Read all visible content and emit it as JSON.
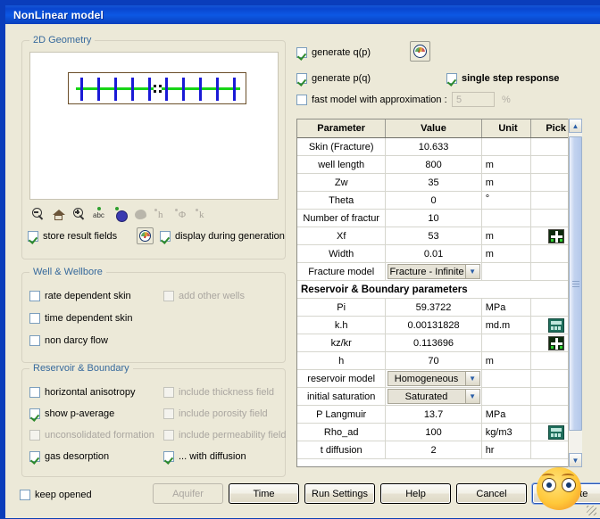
{
  "window": {
    "title": "NonLinear model"
  },
  "geometry_group": {
    "legend": "2D Geometry",
    "toolbar": [
      {
        "name": "zoom-out-icon",
        "label": "zoom out"
      },
      {
        "name": "home-icon",
        "label": "reset view"
      },
      {
        "name": "zoom-in-icon",
        "label": "zoom in"
      },
      {
        "name": "abc-icon",
        "label": "abc"
      },
      {
        "name": "grid-icon",
        "label": "grid"
      },
      {
        "name": "shape-icon",
        "label": "shape"
      },
      {
        "name": "h-icon",
        "label": "h"
      },
      {
        "name": "phi-icon",
        "label": "Φ"
      },
      {
        "name": "k-icon",
        "label": "k"
      }
    ],
    "fracture_count": 10,
    "store_result_fields": {
      "label": "store result fields",
      "checked": true
    },
    "display_during_generation": {
      "label": "display during generation",
      "checked": true
    },
    "gauge_icon": "gauge-icon"
  },
  "well_group": {
    "legend": "Well & Wellbore",
    "options": [
      {
        "label": "rate dependent skin",
        "checked": false,
        "disabled": false
      },
      {
        "label": "add other wells",
        "checked": false,
        "disabled": true
      },
      {
        "label": "time dependent skin",
        "checked": false,
        "disabled": false
      },
      {
        "label": "non darcy flow",
        "checked": false,
        "disabled": false
      }
    ]
  },
  "reservoir_group": {
    "legend": "Reservoir & Boundary",
    "options": [
      {
        "label": "horizontal anisotropy",
        "checked": false,
        "disabled": false
      },
      {
        "label": "include thickness field",
        "checked": false,
        "disabled": true
      },
      {
        "label": "show p-average",
        "checked": true,
        "disabled": false
      },
      {
        "label": "include porosity field",
        "checked": false,
        "disabled": true
      },
      {
        "label": "unconsolidated formation",
        "checked": false,
        "disabled": true
      },
      {
        "label": "include permeability field",
        "checked": false,
        "disabled": true
      },
      {
        "label": "gas desorption",
        "checked": true,
        "disabled": false
      },
      {
        "label": "... with diffusion",
        "checked": true,
        "disabled": false
      }
    ]
  },
  "generate_options": {
    "generate_qp": {
      "label": "generate q(p)",
      "checked": true
    },
    "generate_pq": {
      "label": "generate p(q)",
      "checked": true
    },
    "single_step_response": {
      "label": "single step response",
      "checked": true
    },
    "fast_model": {
      "label": "fast model with approximation :",
      "checked": false
    },
    "fast_model_value": "5",
    "fast_model_unit": "%",
    "gauge_icon": "gauge-icon"
  },
  "table": {
    "columns": [
      "Parameter",
      "Value",
      "Unit",
      "Pick"
    ],
    "rows": [
      {
        "parameter": "Skin (Fracture)",
        "value": "10.633",
        "unit": "",
        "pick": ""
      },
      {
        "parameter": "well length",
        "value": "800",
        "unit": "m",
        "pick": ""
      },
      {
        "parameter": "Zw",
        "value": "35",
        "unit": "m",
        "pick": ""
      },
      {
        "parameter": "Theta",
        "value": "0",
        "unit": "°",
        "pick": ""
      },
      {
        "parameter": "Number of fractur",
        "value": "10",
        "unit": "",
        "pick": ""
      },
      {
        "parameter": "Xf",
        "value": "53",
        "unit": "m",
        "pick": "picker"
      },
      {
        "parameter": "Width",
        "value": "0.01",
        "unit": "m",
        "pick": ""
      },
      {
        "parameter": "Fracture model",
        "value": "Fracture - Infinite c",
        "unit": "",
        "pick": "",
        "type": "combo"
      },
      {
        "parameter": "Reservoir & Boundary parameters",
        "type": "section"
      },
      {
        "parameter": "Pi",
        "value": "59.3722",
        "unit": "MPa",
        "pick": ""
      },
      {
        "parameter": "k.h",
        "value": "0.00131828",
        "unit": "md.m",
        "pick": "calc"
      },
      {
        "parameter": "kz/kr",
        "value": "0.113696",
        "unit": "",
        "pick": "picker"
      },
      {
        "parameter": "h",
        "value": "70",
        "unit": "m",
        "pick": ""
      },
      {
        "parameter": "reservoir model",
        "value": "Homogeneous",
        "unit": "",
        "pick": "",
        "type": "combo"
      },
      {
        "parameter": "initial saturation",
        "value": "Saturated",
        "unit": "",
        "pick": "",
        "type": "combo"
      },
      {
        "parameter": "P Langmuir",
        "value": "13.7",
        "unit": "MPa",
        "pick": ""
      },
      {
        "parameter": "Rho_ad",
        "value": "100",
        "unit": "kg/m3",
        "pick": "calc"
      },
      {
        "parameter": "t diffusion",
        "value": "2",
        "unit": "hr",
        "pick": ""
      }
    ],
    "scroll_up": "▲",
    "scroll_down": "▼"
  },
  "footer": {
    "keep_opened": {
      "label": "keep opened",
      "checked": false
    },
    "buttons": [
      {
        "label": "Aquifer",
        "name": "aquifer-button",
        "disabled": true
      },
      {
        "label": "Time",
        "name": "time-button",
        "disabled": false
      },
      {
        "label": "Run Settings",
        "name": "run-settings-button",
        "disabled": false
      },
      {
        "label": "Help",
        "name": "help-button",
        "disabled": false
      },
      {
        "label": "Cancel",
        "name": "cancel-button",
        "disabled": false
      },
      {
        "label": "Generate",
        "name": "generate-button",
        "disabled": false,
        "default": true
      }
    ]
  },
  "colors": {
    "title_bar": "#0c58e4",
    "dialog_face": "#ece9d8",
    "legend_text": "#36699c",
    "fracture_blue": "#1a1ad6",
    "well_green": "#17d417",
    "check_green": "#2d8a2d"
  }
}
